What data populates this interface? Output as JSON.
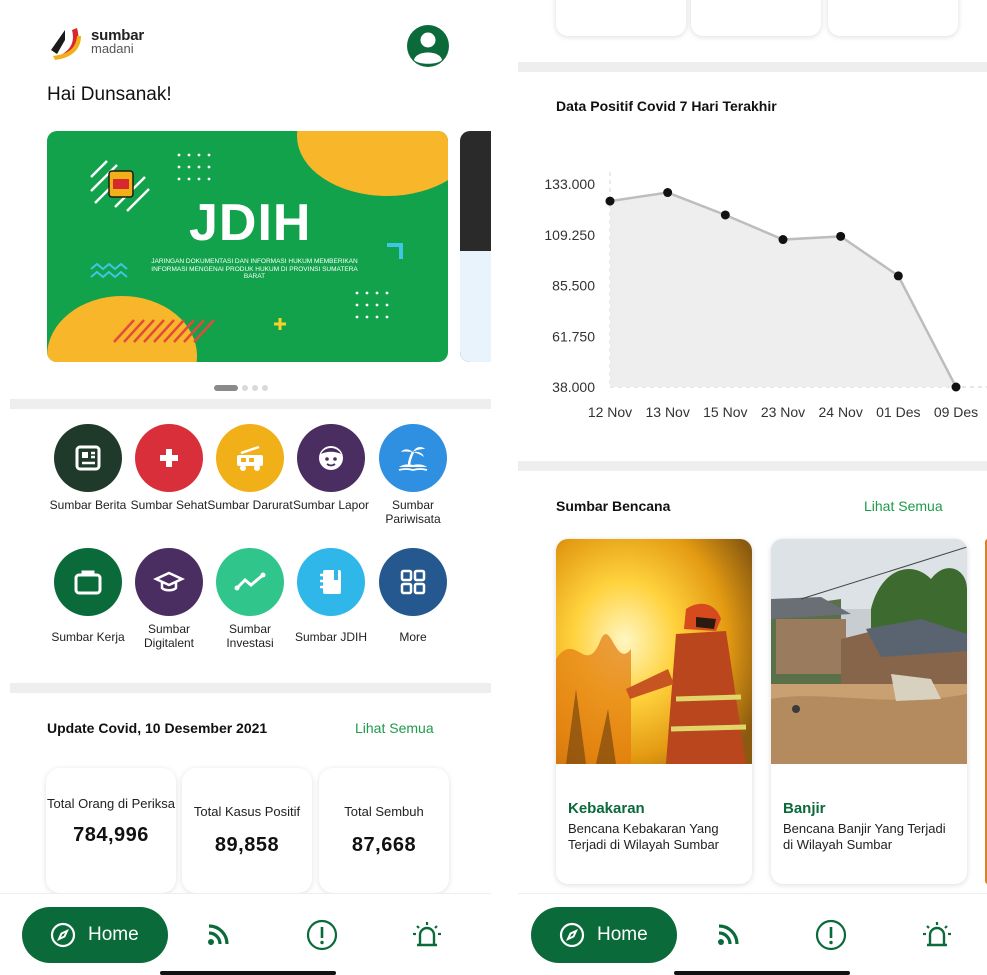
{
  "left": {
    "logo": {
      "line1": "sumbar",
      "line2": "madani"
    },
    "greeting": "Hai Dunsanak!",
    "banner": {
      "title": "JDIH",
      "subtitle": "JARINGAN DOKUMENTASI DAN INFORMASI HUKUM MEMBERIKAN INFORMASI MENGENAI PRODUK HUKUM DI PROVINSI SUMATERA BARAT",
      "active_dot": 1,
      "dot_count": 4
    },
    "menu": [
      {
        "label": "Sumbar Berita",
        "icon": "newspaper-icon",
        "color": "#1f3a2b"
      },
      {
        "label": "Sumbar Sehat",
        "icon": "medical-cross-icon",
        "color": "#d92f3a"
      },
      {
        "label": "Sumbar Darurat",
        "icon": "fire-truck-icon",
        "color": "#f2b018"
      },
      {
        "label": "Sumbar Lapor",
        "icon": "face-icon",
        "color": "#4a2e62"
      },
      {
        "label": "Sumbar Pariwisata",
        "icon": "island-icon",
        "color": "#2f8fe0"
      },
      {
        "label": "Sumbar Kerja",
        "icon": "briefcase-icon",
        "color": "#0b6a3a"
      },
      {
        "label": "Sumbar Digitalent",
        "icon": "graduation-cap-icon",
        "color": "#4a2e62"
      },
      {
        "label": "Sumbar Investasi",
        "icon": "trend-icon",
        "color": "#30c58a"
      },
      {
        "label": "Sumbar JDIH",
        "icon": "book-icon",
        "color": "#2fb7ea"
      },
      {
        "label": "More",
        "icon": "grid-icon",
        "color": "#24588f"
      }
    ],
    "covid": {
      "title": "Update Covid, 10 Desember 2021",
      "see_all": "Lihat Semua",
      "cards": [
        {
          "label": "Total Orang di Periksa",
          "value": "784,996"
        },
        {
          "label": "Total Kasus Positif",
          "value": "89,858"
        },
        {
          "label": "Total Sembuh",
          "value": "87,668"
        }
      ]
    },
    "nav": {
      "home": "Home"
    }
  },
  "right": {
    "chart_title": "Data Positif Covid 7 Hari Terakhir",
    "chart_data": {
      "type": "area",
      "title": "Data Positif Covid 7 Hari Terakhir",
      "categories": [
        "12 Nov",
        "13 Nov",
        "15 Nov",
        "23 Nov",
        "24 Nov",
        "01 Des",
        "09 Des"
      ],
      "values": [
        125000,
        129000,
        118500,
        107000,
        108500,
        90000,
        38000
      ],
      "ytick_labels": [
        "133.000",
        "109.250",
        "85.500",
        "61.750",
        "38.000"
      ],
      "yticks": [
        133000,
        109250,
        85500,
        61750,
        38000
      ],
      "ylim": [
        38000,
        133000
      ],
      "xlabel": "",
      "ylabel": "",
      "grid": false
    },
    "bencana": {
      "title": "Sumbar Bencana",
      "see_all": "Lihat Semua",
      "cards": [
        {
          "title": "Kebakaran",
          "desc": "Bencana Kebakaran Yang Terjadi di Wilayah Sumbar"
        },
        {
          "title": "Banjir",
          "desc": "Bencana Banjir Yang Terjadi di Wilayah Sumbar"
        }
      ]
    },
    "nav": {
      "home": "Home"
    }
  },
  "colors": {
    "primary": "#0b6a3a",
    "accent_green": "#1e9b4a",
    "banner_green": "#12a24c",
    "banner_yellow": "#f8b72a"
  }
}
